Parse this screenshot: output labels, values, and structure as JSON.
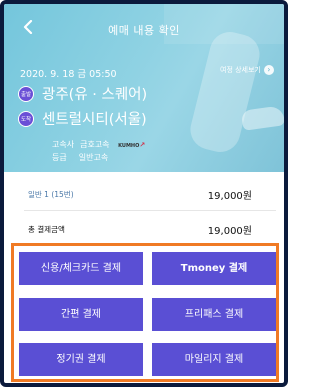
{
  "header": {
    "title": "예매 내용 확인",
    "back_icon": "chevron-left-icon"
  },
  "trip": {
    "date": "2020. 9. 18 금 05:50",
    "detail_link": "여정 상세보기",
    "departure": {
      "badge": "출발",
      "name": "광주(유 · 스퀘어)"
    },
    "arrival": {
      "badge": "도착",
      "name": "센트럴시티(서울)"
    },
    "company_label": "고속사",
    "company": "금호고속",
    "company_logo": "KUMHO",
    "grade_label": "등급",
    "grade": "일반고속"
  },
  "fares": {
    "adult_label": "일반 1 (15번)",
    "adult_amount": "19,000원",
    "total_label": "총 결제금액",
    "total_amount": "19,000원"
  },
  "payment": {
    "card": "신용/체크카드 결제",
    "tmoney": "Tmoney 결제",
    "simple": "간편 결제",
    "freepass": "프리패스 결제",
    "season": "정기권 결제",
    "mileage": "마일리지 결제"
  },
  "colors": {
    "hero": "#7fc9de",
    "button": "#5a4fd4",
    "highlight_border": "#f07a24",
    "badge": "#6a4fd6"
  }
}
